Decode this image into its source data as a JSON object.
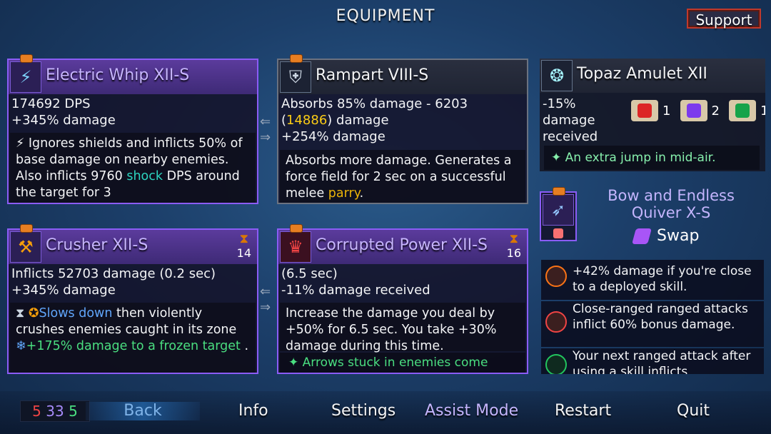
{
  "header": {
    "title": "EQUIPMENT",
    "support_label": "Support"
  },
  "weapons": [
    {
      "name": "Electric Whip XII-S",
      "stats": [
        "174692 DPS",
        "+345% damage"
      ],
      "desc_pre": "⚡ Ignores shields and inflicts 50% of base damage on nearby enemies. Also inflicts 9760 ",
      "desc_kw": "shock",
      "desc_post": " DPS around the target for 3"
    },
    {
      "name": "Rampart VIII-S",
      "stats_line1": "Absorbs 85% damage - 6203",
      "stats_paren_open": "(",
      "stats_gold": "14886",
      "stats_paren_close": ") damage",
      "stats_line3": "+254% damage",
      "desc_pre": "Absorbs more damage. Generates a force field for 2 sec on a successful melee ",
      "desc_kw": "parry",
      "desc_post": "."
    }
  ],
  "skills": [
    {
      "name": "Crusher XII-S",
      "cooldown": "14",
      "stats": [
        "Inflicts 52703 damage (0.2 sec)",
        "+345% damage"
      ],
      "desc_kw1": "Slows down",
      "desc_mid": " then violently crushes enemies caught in its zone",
      "desc_green": "+175% damage to a frozen target",
      "desc_end": " ."
    },
    {
      "name": "Corrupted Power XII-S",
      "cooldown": "16",
      "stats": [
        "(6.5 sec)",
        "-11% damage received"
      ],
      "desc": "Increase the damage you deal by +50% for 6.5 sec. You take +30% damage during this time.",
      "curse": "Arrows stuck in enemies come"
    }
  ],
  "amulet": {
    "name": "Topaz Amulet XII",
    "stat": "-15% damage received",
    "scrolls": [
      {
        "count": "1",
        "color": "#dc2626"
      },
      {
        "count": "2",
        "color": "#7c3aed"
      },
      {
        "count": "1",
        "color": "#16a34a"
      }
    ],
    "bonus": "An extra jump in mid-air."
  },
  "ranged": {
    "name_line1": "Bow and Endless",
    "name_line2": "Quiver X-S",
    "swap_label": "Swap"
  },
  "perks": [
    "+42% damage if you're close to a deployed skill.",
    "Close-ranged ranged attacks inflict 60% bonus damage.",
    "Your next ranged attack after using a skill inflicts"
  ],
  "counter": {
    "red": "5",
    "purple": "33",
    "green": "5",
    "colors": {
      "red": "#ef4444",
      "purple": "#a78bfa",
      "green": "#4ade80"
    }
  },
  "nav": {
    "back": "Back",
    "info": "Info",
    "settings": "Settings",
    "assist": "Assist Mode",
    "restart": "Restart",
    "quit": "Quit"
  }
}
